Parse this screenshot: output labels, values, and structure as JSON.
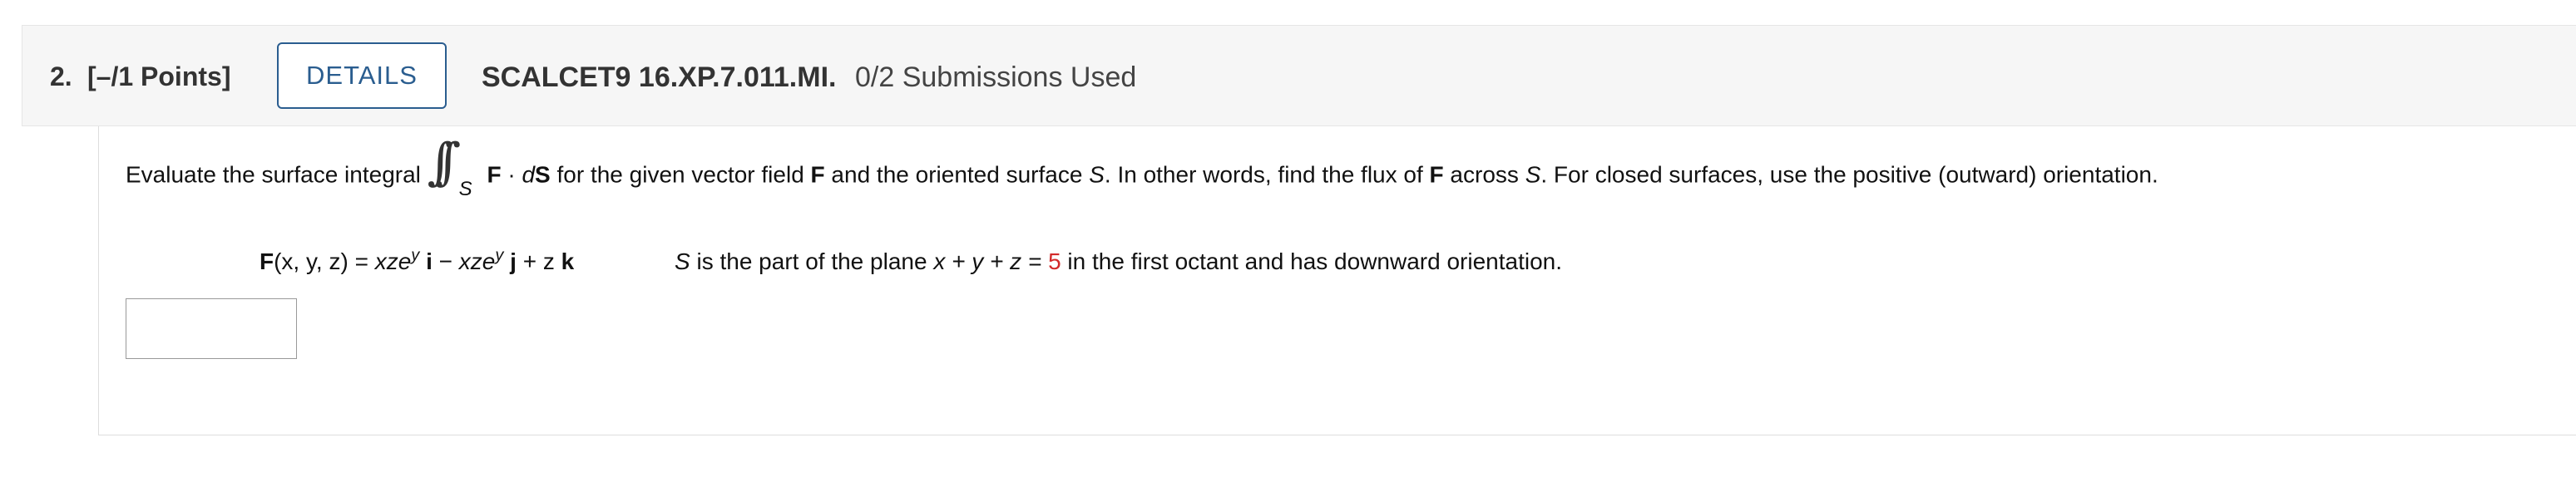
{
  "question": {
    "number": "2.",
    "points": "[–/1 Points]",
    "details_label": "DETAILS",
    "code": "SCALCET9 16.XP.7.011.MI.",
    "submissions": "0/2 Submissions Used"
  },
  "prompt": {
    "before_integral": "Evaluate the surface integral",
    "integral_symbol": "∫∫",
    "integral_sub": "S",
    "after_integral_a": "F",
    "after_integral_dot": " · ",
    "after_integral_d": "d",
    "after_integral_s": "S",
    "rest_1": " for the given vector field ",
    "rest_F1": "F",
    "rest_2": " and the oriented surface ",
    "rest_S1": "S",
    "rest_3": ". In other words, find the flux of ",
    "rest_F2": "F",
    "rest_4": " across ",
    "rest_S2": "S",
    "rest_5": ". For closed surfaces, use the positive (outward) orientation."
  },
  "field": {
    "F": "F",
    "args": "(x, y, z) = ",
    "xze1": "xze",
    "y1": "y",
    "i": " i",
    "minus": " − ",
    "xze2": "xze",
    "y2": "y",
    "j": " j",
    "plus_z": " + z ",
    "k": "k"
  },
  "surface": {
    "S": "S",
    "text_1": " is the part of the plane ",
    "eq": "x + y + z = ",
    "value": "5",
    "text_2": " in the first octant and has downward orientation."
  },
  "answer": {
    "value": ""
  }
}
